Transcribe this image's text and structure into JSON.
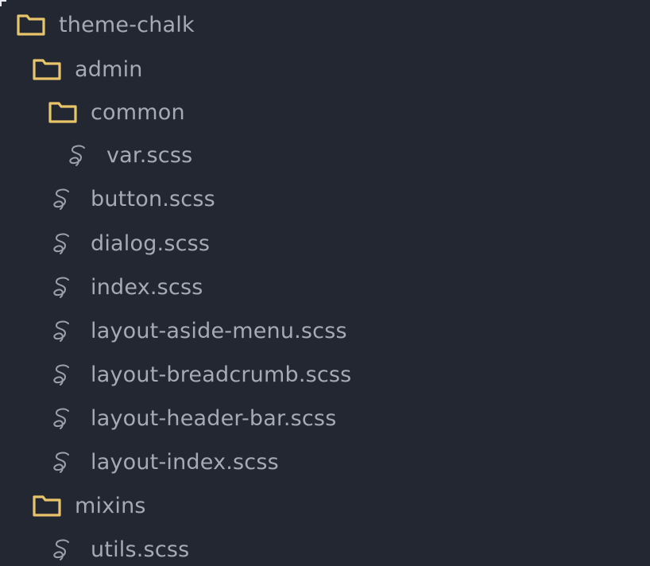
{
  "colors": {
    "background": "#232731",
    "text": "#a6aab5",
    "folder_icon": "#e8c46b",
    "sass_icon": "#9ba0ab"
  },
  "tree": {
    "items": [
      {
        "label": "theme-chalk",
        "type": "folder",
        "icon": "folder-icon"
      },
      {
        "label": "admin",
        "type": "folder",
        "icon": "folder-icon"
      },
      {
        "label": "common",
        "type": "folder",
        "icon": "folder-icon"
      },
      {
        "label": "var.scss",
        "type": "file",
        "icon": "sass-file-icon"
      },
      {
        "label": "button.scss",
        "type": "file",
        "icon": "sass-file-icon"
      },
      {
        "label": "dialog.scss",
        "type": "file",
        "icon": "sass-file-icon"
      },
      {
        "label": "index.scss",
        "type": "file",
        "icon": "sass-file-icon"
      },
      {
        "label": "layout-aside-menu.scss",
        "type": "file",
        "icon": "sass-file-icon"
      },
      {
        "label": "layout-breadcrumb.scss",
        "type": "file",
        "icon": "sass-file-icon"
      },
      {
        "label": "layout-header-bar.scss",
        "type": "file",
        "icon": "sass-file-icon"
      },
      {
        "label": "layout-index.scss",
        "type": "file",
        "icon": "sass-file-icon"
      },
      {
        "label": "mixins",
        "type": "folder",
        "icon": "folder-icon"
      },
      {
        "label": "utils.scss",
        "type": "file",
        "icon": "sass-file-icon"
      }
    ]
  }
}
